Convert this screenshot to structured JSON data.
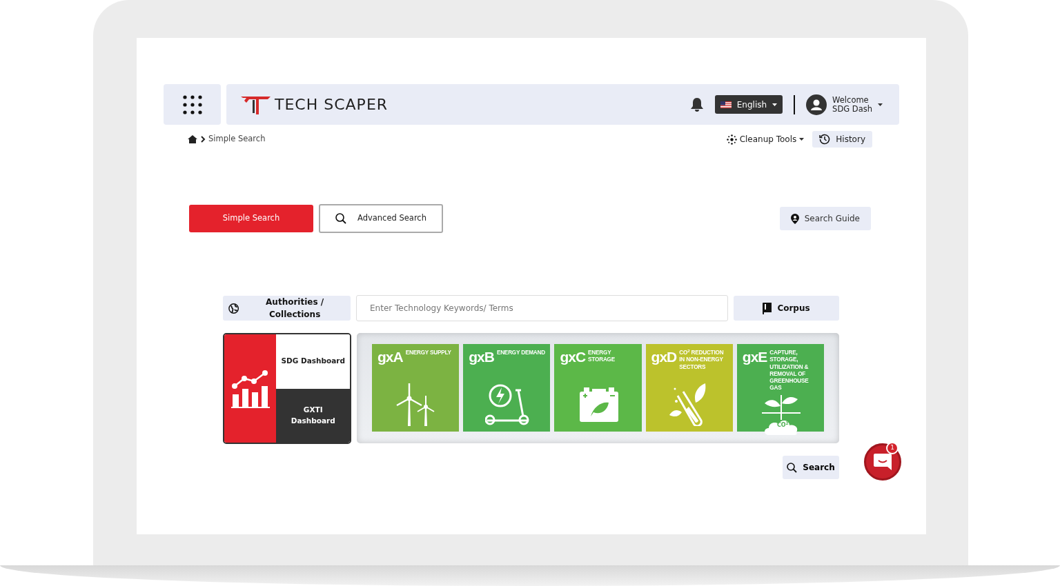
{
  "header": {
    "logo_text": "TECH SCAPER",
    "language": "English",
    "user_greeting": "Welcome",
    "user_name": "SDG Dash"
  },
  "breadcrumb": {
    "current": "Simple Search"
  },
  "tools": [
    {
      "label": "Cleanup Tools",
      "kind": "dropdown"
    },
    {
      "label": "History",
      "kind": "button"
    }
  ],
  "modes": [
    {
      "label": "Simple Search",
      "selected": true
    },
    {
      "label": "Advanced Search",
      "selected": false
    }
  ],
  "search_guide": "Search Guide",
  "search": {
    "authorities": "Authorities / Collections",
    "placeholder": "Enter Technology Keywords/ Terms",
    "corpus": "Corpus",
    "button": "Search"
  },
  "dashboards": [
    {
      "label": "SDG Dashboard",
      "kind": "light"
    },
    {
      "label": "GXTI Dashboard",
      "kind": "dark"
    }
  ],
  "categories": [
    {
      "code": "gxA",
      "title": "ENERGY SUPPLY",
      "color": "#7cb342",
      "kind": "turbines"
    },
    {
      "code": "gxB",
      "title": "ENERGY DEMAND",
      "color": "#4caf50",
      "kind": "scooter"
    },
    {
      "code": "gxC",
      "title": "ENERGY STORAGE",
      "color": "#5cb848",
      "kind": "battery"
    },
    {
      "code": "gxD",
      "title": "CO$^{2}$ REDUCTION IN NON-ENERGY SECTORS",
      "color": "#bcc22c",
      "kind": "tube"
    },
    {
      "code": "gxE",
      "title": "CAPTURE, STORAGE, UTILIZATION & REMOVAL OF GREENHOUSE GAS",
      "color": "#4caf50",
      "kind": "plant",
      "icon_text": "CO$^{2}$"
    }
  ],
  "chat": {
    "badge": "1"
  }
}
